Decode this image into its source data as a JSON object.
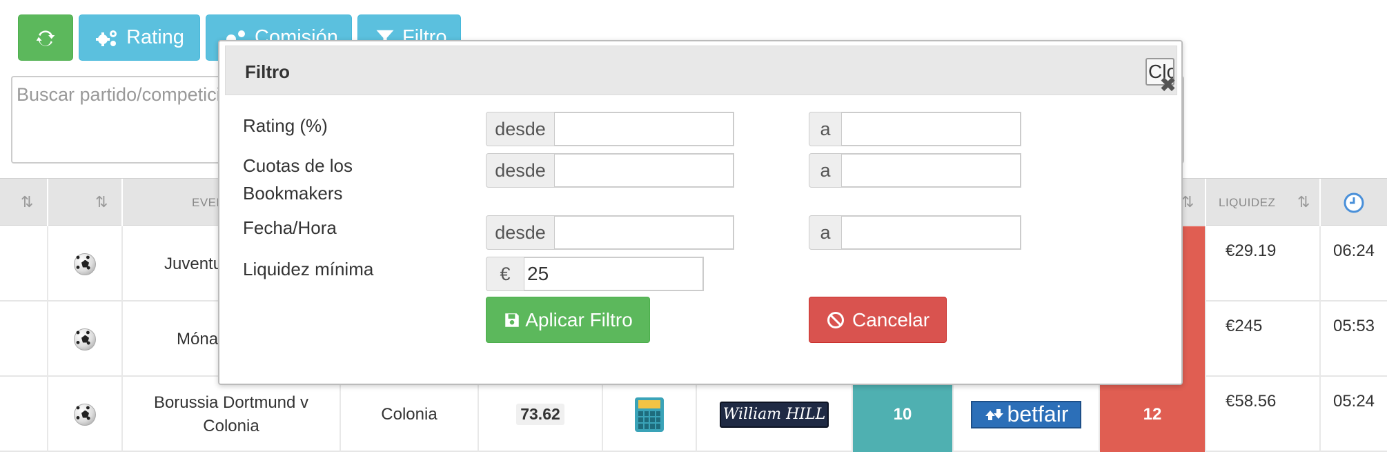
{
  "toolbar": {
    "refresh_icon": "refresh-icon",
    "rating_label": "Rating",
    "comision_label": "Comisión",
    "filtro_label": "Filtro"
  },
  "search": {
    "placeholder": "Buscar partido/competición"
  },
  "table": {
    "header_evento": "EVENTO",
    "header_liquidez": "LIQUIDEZ",
    "rows": [
      {
        "event": "Juventus v Chievo",
        "liquidez": "€29.19",
        "time": "06:24"
      },
      {
        "event": "Mónaco v Lille",
        "liquidez": "€245",
        "time": "05:53"
      },
      {
        "event": "Borussia Dortmund v Colonia",
        "competition": "Colonia",
        "rating": "73.62",
        "bookmaker": "William HILL",
        "back_odds": "10",
        "exchange": "betfair",
        "lay_odds": "12",
        "liquidez": "€58.56",
        "time": "05:24"
      }
    ]
  },
  "modal": {
    "title": "Filtro",
    "close_label": "Close",
    "rating_label": "Rating (%)",
    "cuotas_label": "Cuotas de los Bookmakers",
    "fecha_label": "Fecha/Hora",
    "liquidez_label": "Liquidez mínima",
    "desde": "desde",
    "a": "a",
    "euro": "€",
    "liquidez_value": "25",
    "apply_label": "Aplicar Filtro",
    "cancel_label": "Cancelar"
  },
  "colors": {
    "green": "#5cb85c",
    "info": "#5bc0de",
    "red_cell": "#e05e52",
    "teal_cell": "#4fb0b1",
    "danger": "#d9534f"
  }
}
